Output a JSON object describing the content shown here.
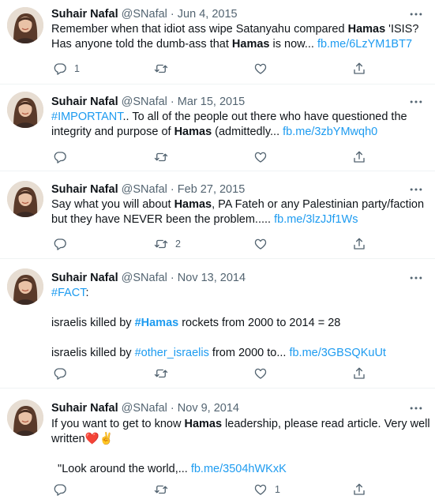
{
  "author": {
    "name": "Suhair Nafal",
    "handle": "@SNafal"
  },
  "separator": "·",
  "colors": {
    "link": "#1d9bf0",
    "text": "#0f1419",
    "muted": "#536471"
  },
  "tweets": [
    {
      "date": "Jun 4, 2015",
      "lines": [
        [
          {
            "t": "Remember when that idiot ass wipe Satanyahu compared "
          },
          {
            "t": "Hamas",
            "s": "b"
          },
          {
            "t": " 'ISIS?"
          }
        ],
        [
          {
            "t": "Has anyone told the dumb-ass that "
          },
          {
            "t": "Hamas",
            "s": "b"
          },
          {
            "t": " is now... "
          },
          {
            "t": "fb.me/6LzYM1BT7",
            "s": "link"
          }
        ]
      ],
      "replies": "1",
      "retweets": "",
      "likes": ""
    },
    {
      "date": "Mar 15, 2015",
      "lines": [
        [
          {
            "t": "#IMPORTANT",
            "s": "link"
          },
          {
            "t": ".. To all of the people out there who have questioned the"
          }
        ],
        [
          {
            "t": "integrity and purpose of "
          },
          {
            "t": "Hamas",
            "s": "b"
          },
          {
            "t": " (admittedly... "
          },
          {
            "t": "fb.me/3zbYMwqh0",
            "s": "link"
          }
        ]
      ],
      "replies": "",
      "retweets": "",
      "likes": ""
    },
    {
      "date": "Feb 27, 2015",
      "lines": [
        [
          {
            "t": "Say what you will about "
          },
          {
            "t": "Hamas",
            "s": "b"
          },
          {
            "t": ", PA Fateh or any Palestinian party/faction"
          }
        ],
        [
          {
            "t": "but they have NEVER been the problem..... "
          },
          {
            "t": "fb.me/3lzJJf1Ws",
            "s": "link"
          }
        ]
      ],
      "replies": "",
      "retweets": "2",
      "likes": ""
    },
    {
      "date": "Nov 13, 2014",
      "lines": [
        [
          {
            "t": "#FACT",
            "s": "link"
          },
          {
            "t": ":"
          }
        ],
        [],
        [
          {
            "t": "israelis killed by "
          },
          {
            "t": "#Hamas",
            "s": "link b"
          },
          {
            "t": " rockets from 2000 to 2014 = 28"
          }
        ],
        [],
        [
          {
            "t": "israelis killed by "
          },
          {
            "t": "#other_israelis",
            "s": "link"
          },
          {
            "t": " from 2000 to... "
          },
          {
            "t": "fb.me/3GBSQKuUt",
            "s": "link"
          }
        ]
      ],
      "replies": "",
      "retweets": "",
      "likes": ""
    },
    {
      "date": "Nov 9, 2014",
      "lines": [
        [
          {
            "t": "If you want to get to know "
          },
          {
            "t": "Hamas",
            "s": "b"
          },
          {
            "t": " leadership, please read article. Very well"
          }
        ],
        [
          {
            "t": "written"
          },
          {
            "t": "❤️✌️"
          }
        ],
        [],
        [
          {
            "t": "  \"Look around the world,... "
          },
          {
            "t": "fb.me/3504hWKxK",
            "s": "link"
          }
        ]
      ],
      "replies": "",
      "retweets": "",
      "likes": "1"
    }
  ]
}
